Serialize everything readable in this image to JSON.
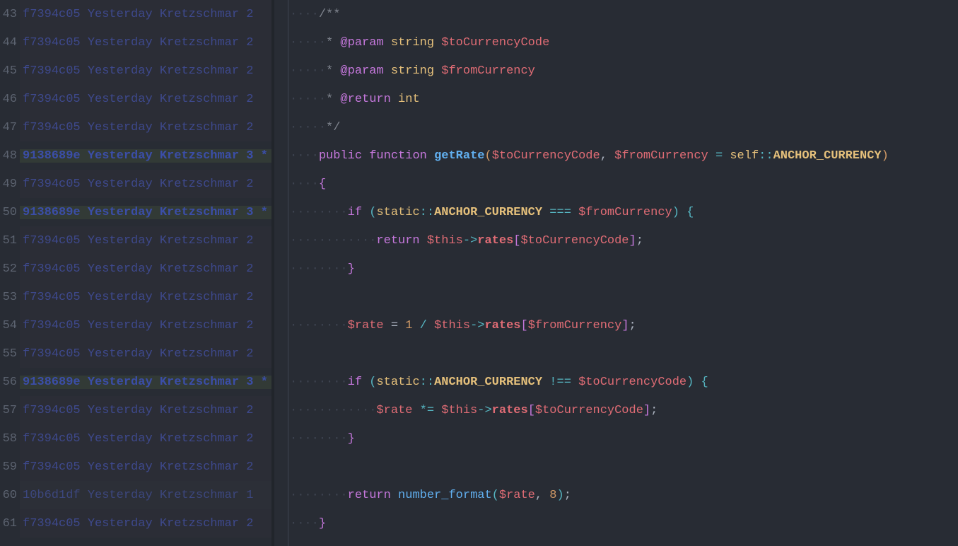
{
  "blame": {
    "lines": [
      {
        "num": 43,
        "hash": "f7394c05",
        "date": "Yesterday",
        "author": "Kretzschmar",
        "rev": "2",
        "star": false,
        "highlighted": false,
        "alt": false
      },
      {
        "num": 44,
        "hash": "f7394c05",
        "date": "Yesterday",
        "author": "Kretzschmar",
        "rev": "2",
        "star": false,
        "highlighted": false,
        "alt": false
      },
      {
        "num": 45,
        "hash": "f7394c05",
        "date": "Yesterday",
        "author": "Kretzschmar",
        "rev": "2",
        "star": false,
        "highlighted": false,
        "alt": false
      },
      {
        "num": 46,
        "hash": "f7394c05",
        "date": "Yesterday",
        "author": "Kretzschmar",
        "rev": "2",
        "star": false,
        "highlighted": false,
        "alt": false
      },
      {
        "num": 47,
        "hash": "f7394c05",
        "date": "Yesterday",
        "author": "Kretzschmar",
        "rev": "2",
        "star": false,
        "highlighted": false,
        "alt": false
      },
      {
        "num": 48,
        "hash": "9138689e",
        "date": "Yesterday",
        "author": "Kretzschmar",
        "rev": "3",
        "star": true,
        "highlighted": true,
        "alt": false
      },
      {
        "num": 49,
        "hash": "f7394c05",
        "date": "Yesterday",
        "author": "Kretzschmar",
        "rev": "2",
        "star": false,
        "highlighted": false,
        "alt": false
      },
      {
        "num": 50,
        "hash": "9138689e",
        "date": "Yesterday",
        "author": "Kretzschmar",
        "rev": "3",
        "star": true,
        "highlighted": true,
        "alt": false
      },
      {
        "num": 51,
        "hash": "f7394c05",
        "date": "Yesterday",
        "author": "Kretzschmar",
        "rev": "2",
        "star": false,
        "highlighted": false,
        "alt": false
      },
      {
        "num": 52,
        "hash": "f7394c05",
        "date": "Yesterday",
        "author": "Kretzschmar",
        "rev": "2",
        "star": false,
        "highlighted": false,
        "alt": false
      },
      {
        "num": 53,
        "hash": "f7394c05",
        "date": "Yesterday",
        "author": "Kretzschmar",
        "rev": "2",
        "star": false,
        "highlighted": false,
        "alt": false
      },
      {
        "num": 54,
        "hash": "f7394c05",
        "date": "Yesterday",
        "author": "Kretzschmar",
        "rev": "2",
        "star": false,
        "highlighted": false,
        "alt": false
      },
      {
        "num": 55,
        "hash": "f7394c05",
        "date": "Yesterday",
        "author": "Kretzschmar",
        "rev": "2",
        "star": false,
        "highlighted": false,
        "alt": false
      },
      {
        "num": 56,
        "hash": "9138689e",
        "date": "Yesterday",
        "author": "Kretzschmar",
        "rev": "3",
        "star": true,
        "highlighted": true,
        "alt": false
      },
      {
        "num": 57,
        "hash": "f7394c05",
        "date": "Yesterday",
        "author": "Kretzschmar",
        "rev": "2",
        "star": false,
        "highlighted": false,
        "alt": false
      },
      {
        "num": 58,
        "hash": "f7394c05",
        "date": "Yesterday",
        "author": "Kretzschmar",
        "rev": "2",
        "star": false,
        "highlighted": false,
        "alt": false
      },
      {
        "num": 59,
        "hash": "f7394c05",
        "date": "Yesterday",
        "author": "Kretzschmar",
        "rev": "2",
        "star": false,
        "highlighted": false,
        "alt": false
      },
      {
        "num": 60,
        "hash": "10b6d1df",
        "date": "Yesterday",
        "author": "Kretzschmar",
        "rev": "1",
        "star": false,
        "highlighted": false,
        "alt": true
      },
      {
        "num": 61,
        "hash": "f7394c05",
        "date": "Yesterday",
        "author": "Kretzschmar",
        "rev": "2",
        "star": false,
        "highlighted": false,
        "alt": false
      }
    ]
  },
  "code": {
    "lines": [
      [
        {
          "t": "ws",
          "v": "····"
        },
        {
          "t": "comment",
          "v": "/**"
        }
      ],
      [
        {
          "t": "ws",
          "v": "·····"
        },
        {
          "t": "comment",
          "v": "* "
        },
        {
          "t": "doctag",
          "v": "@param"
        },
        {
          "t": "comment",
          "v": " "
        },
        {
          "t": "doctype",
          "v": "string"
        },
        {
          "t": "comment",
          "v": " "
        },
        {
          "t": "docvar",
          "v": "$toCurrencyCode"
        }
      ],
      [
        {
          "t": "ws",
          "v": "·····"
        },
        {
          "t": "comment",
          "v": "* "
        },
        {
          "t": "doctag",
          "v": "@param"
        },
        {
          "t": "comment",
          "v": " "
        },
        {
          "t": "doctype",
          "v": "string"
        },
        {
          "t": "comment",
          "v": " "
        },
        {
          "t": "docvar",
          "v": "$fromCurrency"
        }
      ],
      [
        {
          "t": "ws",
          "v": "·····"
        },
        {
          "t": "comment",
          "v": "* "
        },
        {
          "t": "doctag",
          "v": "@return"
        },
        {
          "t": "comment",
          "v": " "
        },
        {
          "t": "doctype",
          "v": "int"
        }
      ],
      [
        {
          "t": "ws",
          "v": "·····"
        },
        {
          "t": "comment",
          "v": "*/"
        }
      ],
      [
        {
          "t": "ws",
          "v": "····"
        },
        {
          "t": "keyword",
          "v": "public"
        },
        {
          "t": "plain",
          "v": " "
        },
        {
          "t": "keyword",
          "v": "function"
        },
        {
          "t": "plain",
          "v": " "
        },
        {
          "t": "funcdef",
          "v": "getRate"
        },
        {
          "t": "paren",
          "v": "("
        },
        {
          "t": "var",
          "v": "$toCurrencyCode"
        },
        {
          "t": "plain",
          "v": ", "
        },
        {
          "t": "var",
          "v": "$fromCurrency"
        },
        {
          "t": "plain",
          "v": " "
        },
        {
          "t": "op",
          "v": "="
        },
        {
          "t": "plain",
          "v": " "
        },
        {
          "t": "self",
          "v": "self"
        },
        {
          "t": "op",
          "v": "::"
        },
        {
          "t": "const",
          "v": "ANCHOR_CURRENCY"
        },
        {
          "t": "paren",
          "v": ")"
        }
      ],
      [
        {
          "t": "ws",
          "v": "····"
        },
        {
          "t": "brace-m",
          "v": "{"
        }
      ],
      [
        {
          "t": "ws",
          "v": "········"
        },
        {
          "t": "keyword",
          "v": "if"
        },
        {
          "t": "plain",
          "v": " "
        },
        {
          "t": "brace-b",
          "v": "("
        },
        {
          "t": "self",
          "v": "static"
        },
        {
          "t": "op",
          "v": "::"
        },
        {
          "t": "const",
          "v": "ANCHOR_CURRENCY"
        },
        {
          "t": "plain",
          "v": " "
        },
        {
          "t": "op",
          "v": "==="
        },
        {
          "t": "plain",
          "v": " "
        },
        {
          "t": "var",
          "v": "$fromCurrency"
        },
        {
          "t": "brace-b",
          "v": ")"
        },
        {
          "t": "plain",
          "v": " "
        },
        {
          "t": "brace-b",
          "v": "{"
        }
      ],
      [
        {
          "t": "ws",
          "v": "············"
        },
        {
          "t": "keyword",
          "v": "return"
        },
        {
          "t": "plain",
          "v": " "
        },
        {
          "t": "var",
          "v": "$this"
        },
        {
          "t": "op",
          "v": "->"
        },
        {
          "t": "prop",
          "v": "rates"
        },
        {
          "t": "bracket",
          "v": "["
        },
        {
          "t": "var",
          "v": "$toCurrencyCode"
        },
        {
          "t": "bracket",
          "v": "]"
        },
        {
          "t": "semi",
          "v": ";"
        }
      ],
      [
        {
          "t": "ws",
          "v": "········"
        },
        {
          "t": "brace-m",
          "v": "}"
        }
      ],
      [
        {
          "t": "ws",
          "v": ""
        }
      ],
      [
        {
          "t": "ws",
          "v": "········"
        },
        {
          "t": "var",
          "v": "$rate"
        },
        {
          "t": "plain",
          "v": " "
        },
        {
          "t": "assign",
          "v": "="
        },
        {
          "t": "plain",
          "v": " "
        },
        {
          "t": "num",
          "v": "1"
        },
        {
          "t": "plain",
          "v": " "
        },
        {
          "t": "op",
          "v": "/"
        },
        {
          "t": "plain",
          "v": " "
        },
        {
          "t": "var",
          "v": "$this"
        },
        {
          "t": "op",
          "v": "->"
        },
        {
          "t": "prop",
          "v": "rates"
        },
        {
          "t": "bracket",
          "v": "["
        },
        {
          "t": "var",
          "v": "$fromCurrency"
        },
        {
          "t": "bracket",
          "v": "]"
        },
        {
          "t": "semi",
          "v": ";"
        }
      ],
      [
        {
          "t": "ws",
          "v": ""
        }
      ],
      [
        {
          "t": "ws",
          "v": "········"
        },
        {
          "t": "keyword",
          "v": "if"
        },
        {
          "t": "plain",
          "v": " "
        },
        {
          "t": "brace-b",
          "v": "("
        },
        {
          "t": "self",
          "v": "static"
        },
        {
          "t": "op",
          "v": "::"
        },
        {
          "t": "const",
          "v": "ANCHOR_CURRENCY"
        },
        {
          "t": "plain",
          "v": " "
        },
        {
          "t": "op",
          "v": "!=="
        },
        {
          "t": "plain",
          "v": " "
        },
        {
          "t": "var",
          "v": "$toCurrencyCode"
        },
        {
          "t": "brace-b",
          "v": ")"
        },
        {
          "t": "plain",
          "v": " "
        },
        {
          "t": "brace-b",
          "v": "{"
        }
      ],
      [
        {
          "t": "ws",
          "v": "············"
        },
        {
          "t": "var",
          "v": "$rate"
        },
        {
          "t": "plain",
          "v": " "
        },
        {
          "t": "op",
          "v": "*="
        },
        {
          "t": "plain",
          "v": " "
        },
        {
          "t": "var",
          "v": "$this"
        },
        {
          "t": "op",
          "v": "->"
        },
        {
          "t": "prop",
          "v": "rates"
        },
        {
          "t": "bracket",
          "v": "["
        },
        {
          "t": "var",
          "v": "$toCurrencyCode"
        },
        {
          "t": "bracket",
          "v": "]"
        },
        {
          "t": "semi",
          "v": ";"
        }
      ],
      [
        {
          "t": "ws",
          "v": "········"
        },
        {
          "t": "brace-m",
          "v": "}"
        }
      ],
      [
        {
          "t": "ws",
          "v": ""
        }
      ],
      [
        {
          "t": "ws",
          "v": "········"
        },
        {
          "t": "keyword",
          "v": "return"
        },
        {
          "t": "plain",
          "v": " "
        },
        {
          "t": "func",
          "v": "number_format"
        },
        {
          "t": "brace-b",
          "v": "("
        },
        {
          "t": "var",
          "v": "$rate"
        },
        {
          "t": "plain",
          "v": ", "
        },
        {
          "t": "num",
          "v": "8"
        },
        {
          "t": "brace-b",
          "v": ")"
        },
        {
          "t": "semi",
          "v": ";"
        }
      ],
      [
        {
          "t": "ws",
          "v": "····"
        },
        {
          "t": "brace-m",
          "v": "}"
        }
      ]
    ]
  }
}
